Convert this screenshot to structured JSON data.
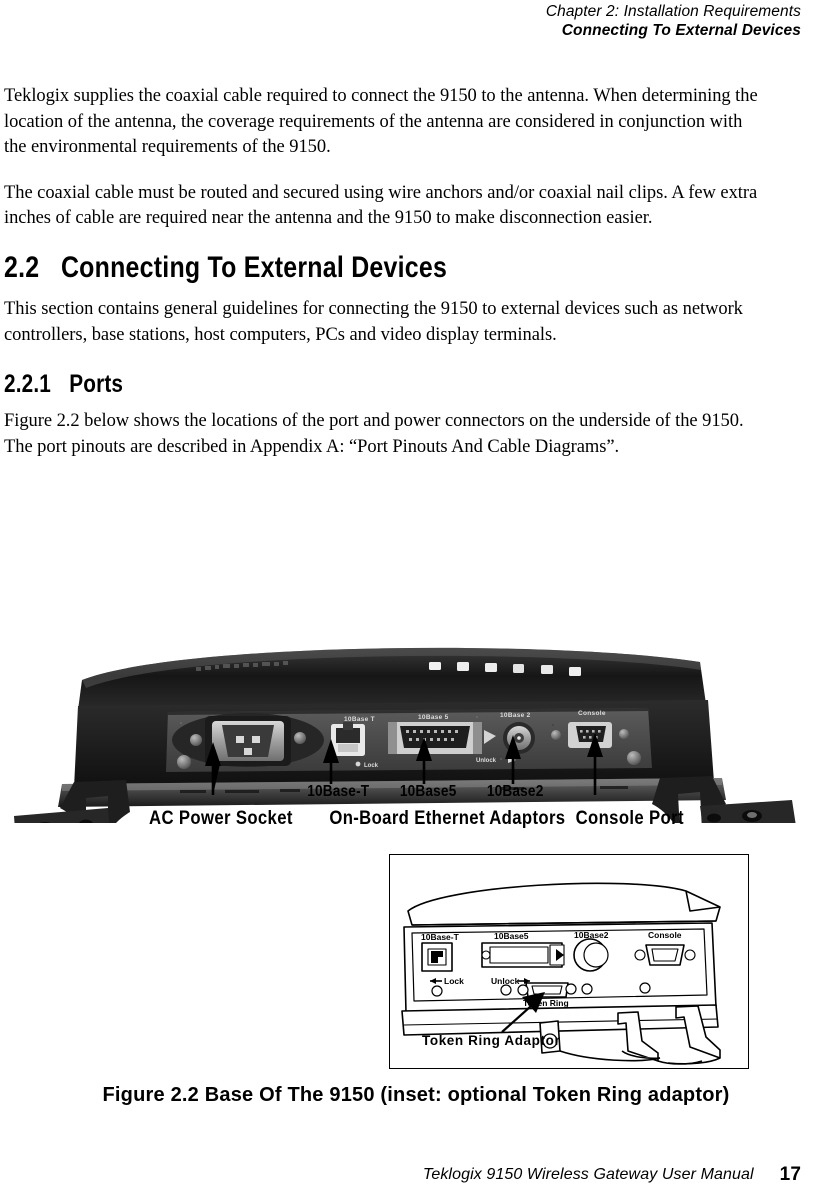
{
  "header": {
    "chapter": "Chapter 2:  Installation Requirements",
    "section": "Connecting To External Devices"
  },
  "body": {
    "paragraph_1": "Teklogix supplies the coaxial cable required to connect the 9150 to the antenna. When determining the location of the antenna, the coverage requirements of the antenna are considered in conjunction with the environmental requirements of the 9150.",
    "paragraph_2": "The coaxial cable must be routed and secured using wire anchors and/or coaxial nail clips. A few extra inches of cable are required near the antenna and the 9150 to make disconnection easier.",
    "paragraph_3": "This section contains general guidelines for connecting the 9150 to external devices such as network controllers, base stations, host computers, PCs and video display terminals.",
    "paragraph_4": "Figure 2.2 below shows the locations of the port and power connectors on the underside of the 9150. The port pinouts are described in Appendix A: “Port Pinouts And Cable Diagrams”."
  },
  "headings": {
    "section_number": "2.2",
    "section_title": "Connecting To External Devices",
    "subsection_number": "2.2.1",
    "subsection_title": "Ports"
  },
  "figure": {
    "caption": "Figure 2.2 Base Of The 9150 (inset: optional Token Ring adaptor)",
    "photo_port_labels": [
      "10Base T",
      "10Base 5",
      "10Base 2",
      "Console"
    ],
    "photo_panel_notes": {
      "lock": "Lock",
      "unlock": "Unlock"
    },
    "callouts": {
      "ac_power": "AC Power Socket",
      "tenbase_t": "10Base-T",
      "tenbase_5": "10Base5",
      "tenbase_2": "10Base2",
      "on_board": "On-Board Ethernet Adaptors",
      "console": "Console Port"
    },
    "inset": {
      "tenbase_t": "10Base-T",
      "tenbase_5": "10Base5",
      "tenbase_2": "10Base2",
      "console": "Console",
      "lock": "Lock",
      "unlock": "Unlock",
      "token_ring": "Token Ring",
      "token_ring_adaptor": "Token Ring Adaptor"
    }
  },
  "footer": {
    "manual": "Teklogix 9150 Wireless Gateway User Manual",
    "page_number": "17"
  },
  "colors": {
    "text": "#000000",
    "page_background": "#ffffff",
    "photo_case_dark": "#1d1d1d",
    "photo_panel": "#4a4a4a"
  }
}
